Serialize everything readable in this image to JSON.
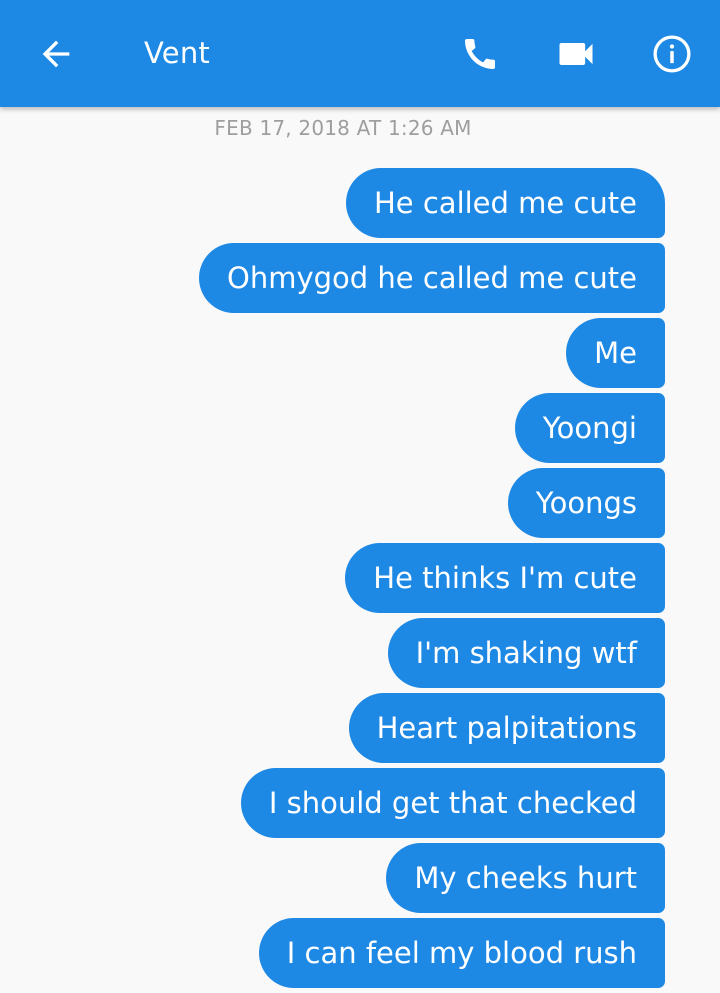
{
  "header": {
    "title": "Vent",
    "background": "#1e88e5",
    "icons": {
      "back": "back-arrow-icon",
      "call": "phone-icon",
      "video": "video-camera-icon",
      "info": "info-icon"
    }
  },
  "thread": {
    "timestamp": "FEB 17, 2018 AT 1:26 AM",
    "bubble_color": "#1e88e5",
    "messages": [
      "He called me cute",
      "Ohmygod he called me cute",
      "Me",
      "Yoongi",
      "Yoongs",
      "He thinks I'm cute",
      "I'm shaking wtf",
      "Heart palpitations",
      "I should get that checked",
      "My cheeks hurt",
      "I can feel my blood rush"
    ]
  }
}
